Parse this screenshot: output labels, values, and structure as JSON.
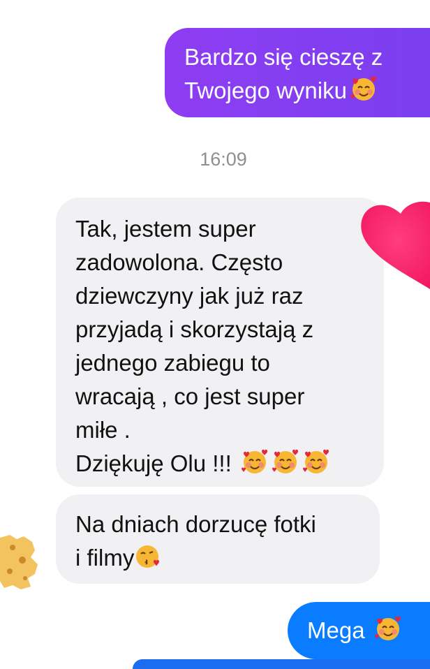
{
  "messages": {
    "outgoing_1": {
      "lines": [
        "Bardzo się cieszę z",
        "Twojego wyniku"
      ],
      "emoji": "smiling-face-with-hearts-icon"
    },
    "timestamp": "16:09",
    "incoming_1": {
      "lines": [
        "Tak, jestem super",
        "zadowolona. Często",
        "dziewczyny jak już raz",
        "przyjadą i skorzystają z",
        "jednego zabiegu to",
        "wracają , co jest super",
        "miłe .",
        "Dziękuję Olu !!!"
      ],
      "emoji": "smiling-face-with-hearts-icon"
    },
    "incoming_2": {
      "lines": [
        "Na dniach dorzucę fotki",
        "i filmy"
      ],
      "emoji": "face-blowing-kiss-icon"
    },
    "outgoing_2": {
      "text": "Mega",
      "emoji": "smiling-face-with-hearts-icon"
    }
  },
  "colors": {
    "outgoing_purple": "#8e3df2",
    "outgoing_blue": "#0a7cff",
    "incoming_gray": "#f1f1f4",
    "timestamp_gray": "#8e8e93",
    "heart_pink": "#ff2a6d"
  }
}
